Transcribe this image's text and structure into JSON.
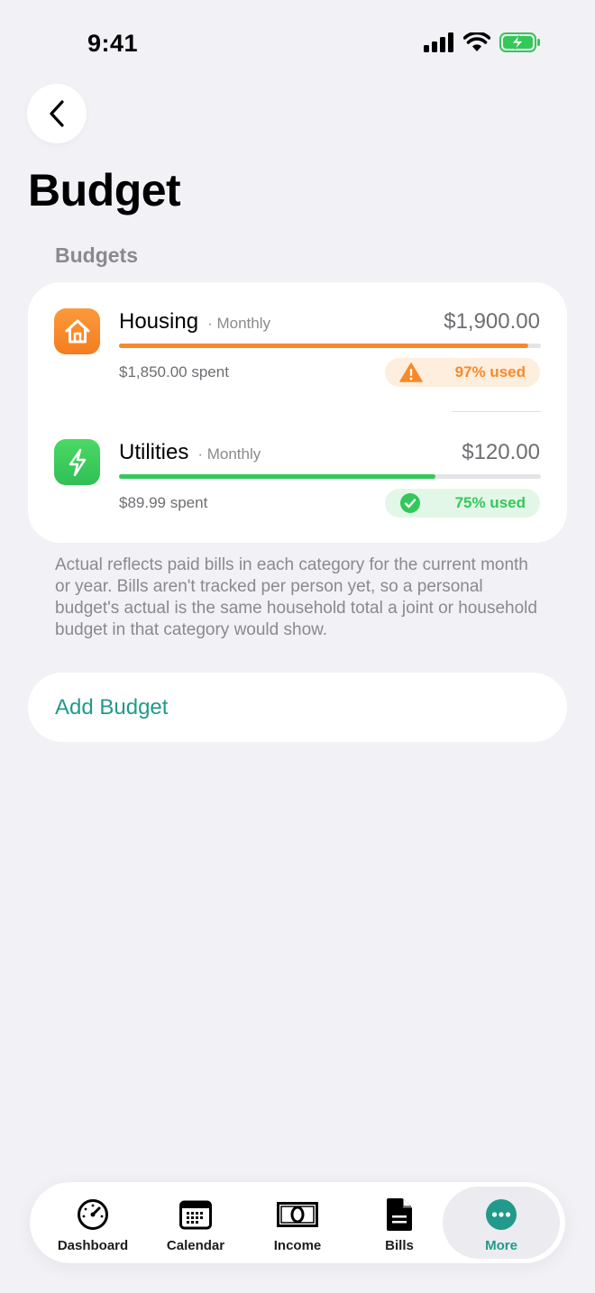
{
  "status_bar": {
    "time": "9:41"
  },
  "page": {
    "title": "Budget",
    "section_header": "Budgets"
  },
  "budgets": [
    {
      "name": "Housing",
      "period": "· Monthly",
      "amount": "$1,900.00",
      "spent": "$1,850.00 spent",
      "used": "97% used",
      "used_fraction": 0.97,
      "status": "warning",
      "icon": "house-icon",
      "color": "#f7892b"
    },
    {
      "name": "Utilities",
      "period": "· Monthly",
      "amount": "$120.00",
      "spent": "$89.99 spent",
      "used": "75% used",
      "used_fraction": 0.75,
      "status": "ok",
      "icon": "bolt-icon",
      "color": "#34c759"
    }
  ],
  "footnote": "Actual reflects paid bills in each category for the current month or year. Bills aren't tracked per person yet, so a personal budget's actual is the same household total a joint or household budget in that category would show.",
  "add_budget_label": "Add Budget",
  "tab_bar": {
    "items": [
      {
        "label": "Dashboard",
        "icon": "gauge-icon"
      },
      {
        "label": "Calendar",
        "icon": "calendar-icon"
      },
      {
        "label": "Income",
        "icon": "banknote-icon"
      },
      {
        "label": "Bills",
        "icon": "document-icon"
      },
      {
        "label": "More",
        "icon": "ellipsis-icon",
        "active": true
      }
    ]
  },
  "colors": {
    "accent": "#219a8b",
    "warning": "#f7892b",
    "success": "#34c759",
    "warning_bg": "#fdeedd",
    "success_bg": "#e2f7e7"
  }
}
